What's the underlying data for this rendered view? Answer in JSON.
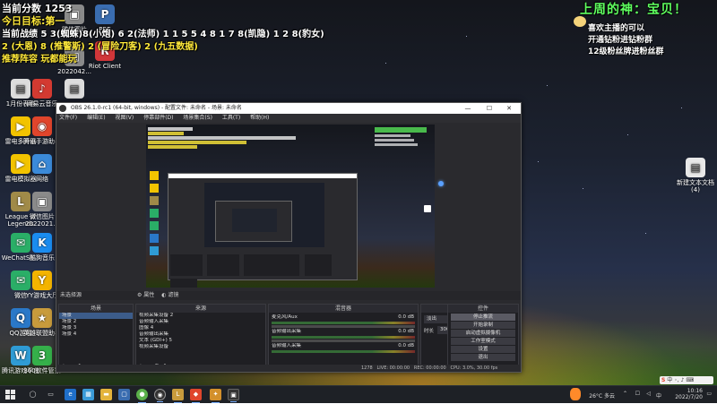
{
  "overlay": {
    "line1": "当前分数 1253",
    "line2": "今日目标:第一",
    "line3": "当前战绩 5 3(蜘蛛)8(小炮) 6 2(法师) 1 1 5 5 4 8 1 7 8(凯隐) 1 2 8(豹女)",
    "line4": "2 (大恩) 8 (推警斯) 2 (冒险刀客) 2 (九五数据)",
    "line5": "推荐阵容 玩都能玩",
    "right_title": "上周的神：宝贝！",
    "right_note1": "喜欢主播的可以",
    "right_note2": "开通钻粉进钻粉群",
    "right_note3": "12级粉丝牌进粉丝群"
  },
  "desktop_icons": [
    {
      "label": "微信图片",
      "icon": "image-file-icon",
      "color": "#8a8a8a"
    },
    {
      "label": "PBE",
      "icon": "lol-pbe-icon",
      "color": "#3a6db0"
    },
    {
      "label": "2022042...",
      "icon": "image-file-icon",
      "color": "#8a8a8a"
    },
    {
      "label": "Riot Client",
      "icon": "riot-client-icon",
      "color": "#d13639"
    },
    {
      "label": "1月份表格",
      "icon": "document-icon",
      "color": "#dcdcdc"
    },
    {
      "label": "网易云音乐",
      "icon": "netease-music-icon",
      "color": "#d33a31"
    },
    {
      "label": "...",
      "icon": "document-icon",
      "color": "#dcdcdc"
    },
    {
      "label": "雷电多开器",
      "icon": "ldplayer-multi-icon",
      "color": "#f2c300"
    },
    {
      "label": "腾讯手游助手",
      "icon": "tencent-assistant-icon",
      "color": "#e0452c"
    },
    {
      "label": "雷电模拟器",
      "icon": "ldplayer-icon",
      "color": "#f2c300"
    },
    {
      "label": "网络",
      "icon": "network-icon",
      "color": "#3b8ad9"
    },
    {
      "label": "League of Legends",
      "icon": "lol-icon",
      "color": "#a08a48"
    },
    {
      "label": "微信图片 2022021...",
      "icon": "image-file-icon",
      "color": "#8a8a8a"
    },
    {
      "label": "WeChatSe...",
      "icon": "wechat-icon",
      "color": "#2aae67"
    },
    {
      "label": "酷狗音乐",
      "icon": "kugou-icon",
      "color": "#1a8cf0"
    },
    {
      "label": "微信",
      "icon": "wechat-icon",
      "color": "#2aae67"
    },
    {
      "label": "YY游戏大厅",
      "icon": "yy-icon",
      "color": "#f4b400"
    },
    {
      "label": "QQ游戏",
      "icon": "qq-game-icon",
      "color": "#2a78c8"
    },
    {
      "label": "英雄联盟助手",
      "icon": "lol-helper-icon",
      "color": "#c89b3c"
    },
    {
      "label": "腾讯游戏平台",
      "icon": "wegame-icon",
      "color": "#2f9bd4"
    },
    {
      "label": "360软件管家",
      "icon": "software-manager-icon",
      "color": "#35b04a"
    },
    {
      "label": "新建文本文档(4)",
      "icon": "text-file-icon",
      "color": "#e8e8e8"
    }
  ],
  "obs": {
    "title": "OBS 26.1.0-rc1 (64-bit, windows) - 配置文件: 未命名 - 场景: 未命名",
    "menu": [
      "文件(F)",
      "编辑(E)",
      "视图(V)",
      "停靠部件(D)",
      "场景集合(S)",
      "工具(T)",
      "帮助(H)"
    ],
    "scene_bar": "未选择源",
    "scene_bar_buttons": [
      "属性",
      "滤镜"
    ],
    "docks": {
      "scenes": {
        "title": "场景",
        "items": [
          "场景",
          "场景 2",
          "场景 3",
          "场景 4"
        ]
      },
      "sources": {
        "title": "来源",
        "items": [
          "视频采集设备 2",
          "音频输入采集",
          "图像 4",
          "音频输出采集",
          "文本 (GDI+) 5",
          "视频采集设备"
        ]
      },
      "mixer": {
        "title": "混音器",
        "channels": [
          {
            "name": "麦克风/Aux",
            "level": "0.0 dB"
          },
          {
            "name": "音频输出采集",
            "level": "0.0 dB"
          },
          {
            "name": "音频输入采集",
            "level": "0.0 dB"
          }
        ]
      },
      "transitions": {
        "title": "转场特效",
        "type": "淡出",
        "duration_label": "时长",
        "duration": "300 ms"
      },
      "controls": {
        "title": "控件",
        "buttons": [
          "停止推流",
          "开始录制",
          "启动虚拟摄像机",
          "工作室模式",
          "设置",
          "退出"
        ]
      }
    },
    "status": {
      "live": "LIVE: 00:00:00",
      "rec": "REC: 00:00:00",
      "cpu": "CPU: 3.0%, 30.00 fps",
      "dropped": "1278"
    }
  },
  "taskbar": {
    "weather": "26°C 多云",
    "ime": "中",
    "time": "10:16",
    "date": "2022/7/20"
  }
}
